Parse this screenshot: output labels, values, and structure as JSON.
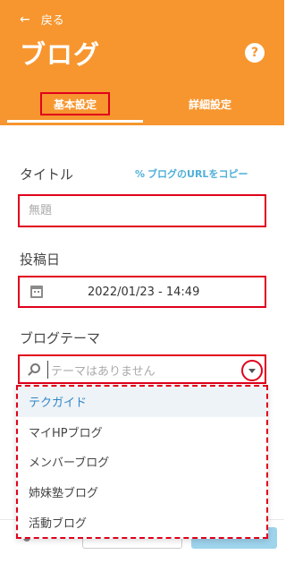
{
  "header": {
    "back_icon": "left-arrow-icon",
    "back_label": "戻る",
    "title": "ブログ",
    "help_label": "?"
  },
  "tabs": [
    {
      "label": "基本設定",
      "active": true
    },
    {
      "label": "詳細設定",
      "active": false
    }
  ],
  "form": {
    "title_label": "タイトル",
    "copy_link_label": "ブログのURLをコピー",
    "copy_link_icon": "link-icon",
    "title_placeholder": "無題",
    "date_label": "投稿日",
    "date_icon": "calendar-icon",
    "date_value": "2022/01/23 - 14:49",
    "theme_label": "ブログテーマ",
    "theme_placeholder": "テーマはありません",
    "theme_search_icon": "search-icon",
    "theme_toggle_icon": "chevron-down-icon"
  },
  "theme_options": [
    {
      "label": "テクガイド",
      "highlighted": true
    },
    {
      "label": "マイHPブログ",
      "highlighted": false
    },
    {
      "label": "メンバーブログ",
      "highlighted": false
    },
    {
      "label": "姉妹塾ブログ",
      "highlighted": false
    },
    {
      "label": "活動ブログ",
      "highlighted": false
    }
  ],
  "colors": {
    "accent": "#F7962F",
    "highlight_border": "#E0001B",
    "link": "#4FB0D9",
    "option_highlight_text": "#2F86C9"
  }
}
